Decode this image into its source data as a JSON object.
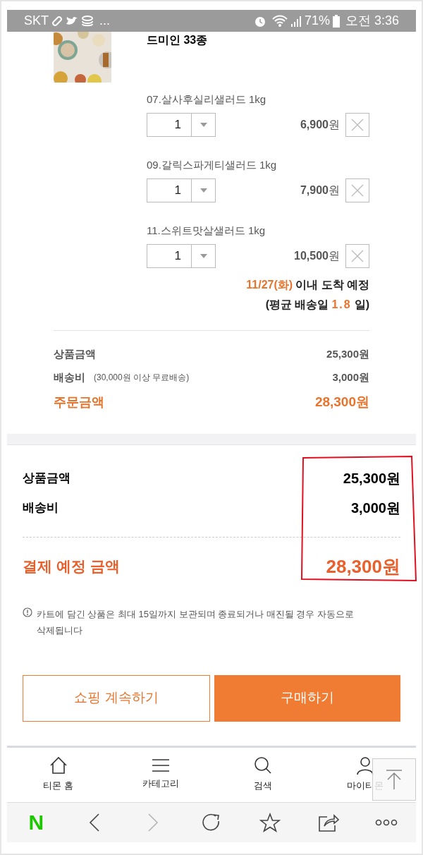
{
  "status_bar": {
    "carrier": "SKT",
    "more": "...",
    "battery": "71%",
    "time": "오전 3:36"
  },
  "product": {
    "title": "드미인 33종",
    "options": [
      {
        "name": "07.살사후실리샐러드 1kg",
        "quantity": "1",
        "price": "**6,900**원"
      },
      {
        "name": "09.갈릭스파게티샐러드 1kg",
        "quantity": "1",
        "price": "**7,900**원"
      },
      {
        "name": "11.스위트맛살샐러드 1kg",
        "quantity": "1",
        "price": "**10,500**원"
      }
    ],
    "delivery": {
      "date": "11/27(화)",
      "text": "이내 도착 예정",
      "avg_prefix": "(평균 배송일",
      "avg_days": "1.8",
      "avg_suffix": "일)"
    }
  },
  "order_summary": [
    {
      "kind": "row",
      "label": "상품금액",
      "amount": "25,300원"
    },
    {
      "kind": "row",
      "label": "배송비",
      "note": "(30,000원 이상 무료배송)",
      "amount": "3,000원"
    },
    {
      "kind": "total",
      "label": "주문금액",
      "amount": "28,300원"
    }
  ],
  "payment_summary": [
    {
      "kind": "row",
      "label": "상품금액",
      "amount": "25,300원"
    },
    {
      "kind": "row",
      "label": "배송비",
      "amount": "3,000원"
    },
    {
      "kind": "total",
      "label": "결제 예정 금액",
      "amount": "28,300원"
    }
  ],
  "notice": "카트에 담긴 상품은 최대 15일까지 보관되며 종료되거나 매진될 경우 자동으로 삭제됩니다",
  "buttons": [
    {
      "kind": "outline",
      "label": "쇼핑 계속하기"
    },
    {
      "kind": "primary",
      "label": "구매하기"
    }
  ],
  "bottom_nav": [
    {
      "label": "티몬 홈"
    },
    {
      "label": "카테고리"
    },
    {
      "label": "검색"
    },
    {
      "label": "마이티몬"
    }
  ],
  "browser_toolbar": [
    {
      "label": "N",
      "disabled": false
    },
    {
      "disabled": false
    },
    {
      "disabled": true
    },
    {
      "disabled": false
    },
    {
      "disabled": false
    },
    {
      "disabled": false
    },
    {
      "disabled": false
    }
  ]
}
